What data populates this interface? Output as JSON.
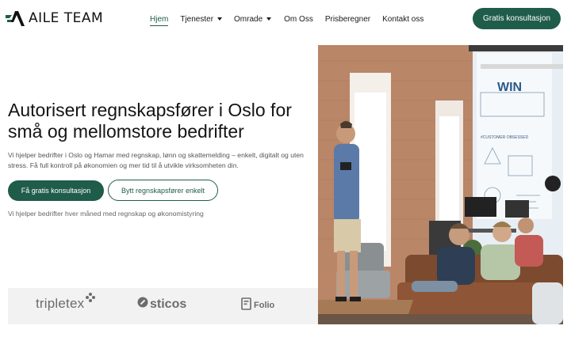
{
  "brand": {
    "name": "AILE TEAM",
    "logo_icon": "aile-logo-icon",
    "accent": "#1f5c4a"
  },
  "nav": {
    "items": [
      {
        "label": "Hjem",
        "active": true,
        "dropdown": false
      },
      {
        "label": "Tjenester",
        "active": false,
        "dropdown": true
      },
      {
        "label": "Omrade",
        "active": false,
        "dropdown": true
      },
      {
        "label": "Om Oss",
        "active": false,
        "dropdown": false
      },
      {
        "label": "Prisberegner",
        "active": false,
        "dropdown": false
      },
      {
        "label": "Kontakt oss",
        "active": false,
        "dropdown": false
      }
    ],
    "cta_label": "Gratis konsultasjon"
  },
  "hero": {
    "title": "Autorisert regnskapsfører i Oslo for små og mellomstore bedrifter",
    "subtitle": "Vi hjelper bedrifter i Oslo og Hamar med regnskap, lønn og skattemelding – enkelt, digitalt og uten stress. Få full kontroll på økonomien og mer tid til å utvikle virksomheten din.",
    "primary_button": "Få gratis konsultasjon",
    "secondary_button": "Bytt regnskapsfører enkelt",
    "note": "Vi hjelper bedrifter hver måned med regnskap og økonomistyring"
  },
  "partners": [
    {
      "name": "tripletex",
      "icon": "tripletex-dots-icon"
    },
    {
      "name": "sticos",
      "icon": "sticos-icon"
    },
    {
      "name": "Folio",
      "icon": "folio-icon"
    }
  ],
  "photo": {
    "wall_sign": "WIN",
    "wall_sign_small": "#CUSTOMER OBSESSED"
  }
}
